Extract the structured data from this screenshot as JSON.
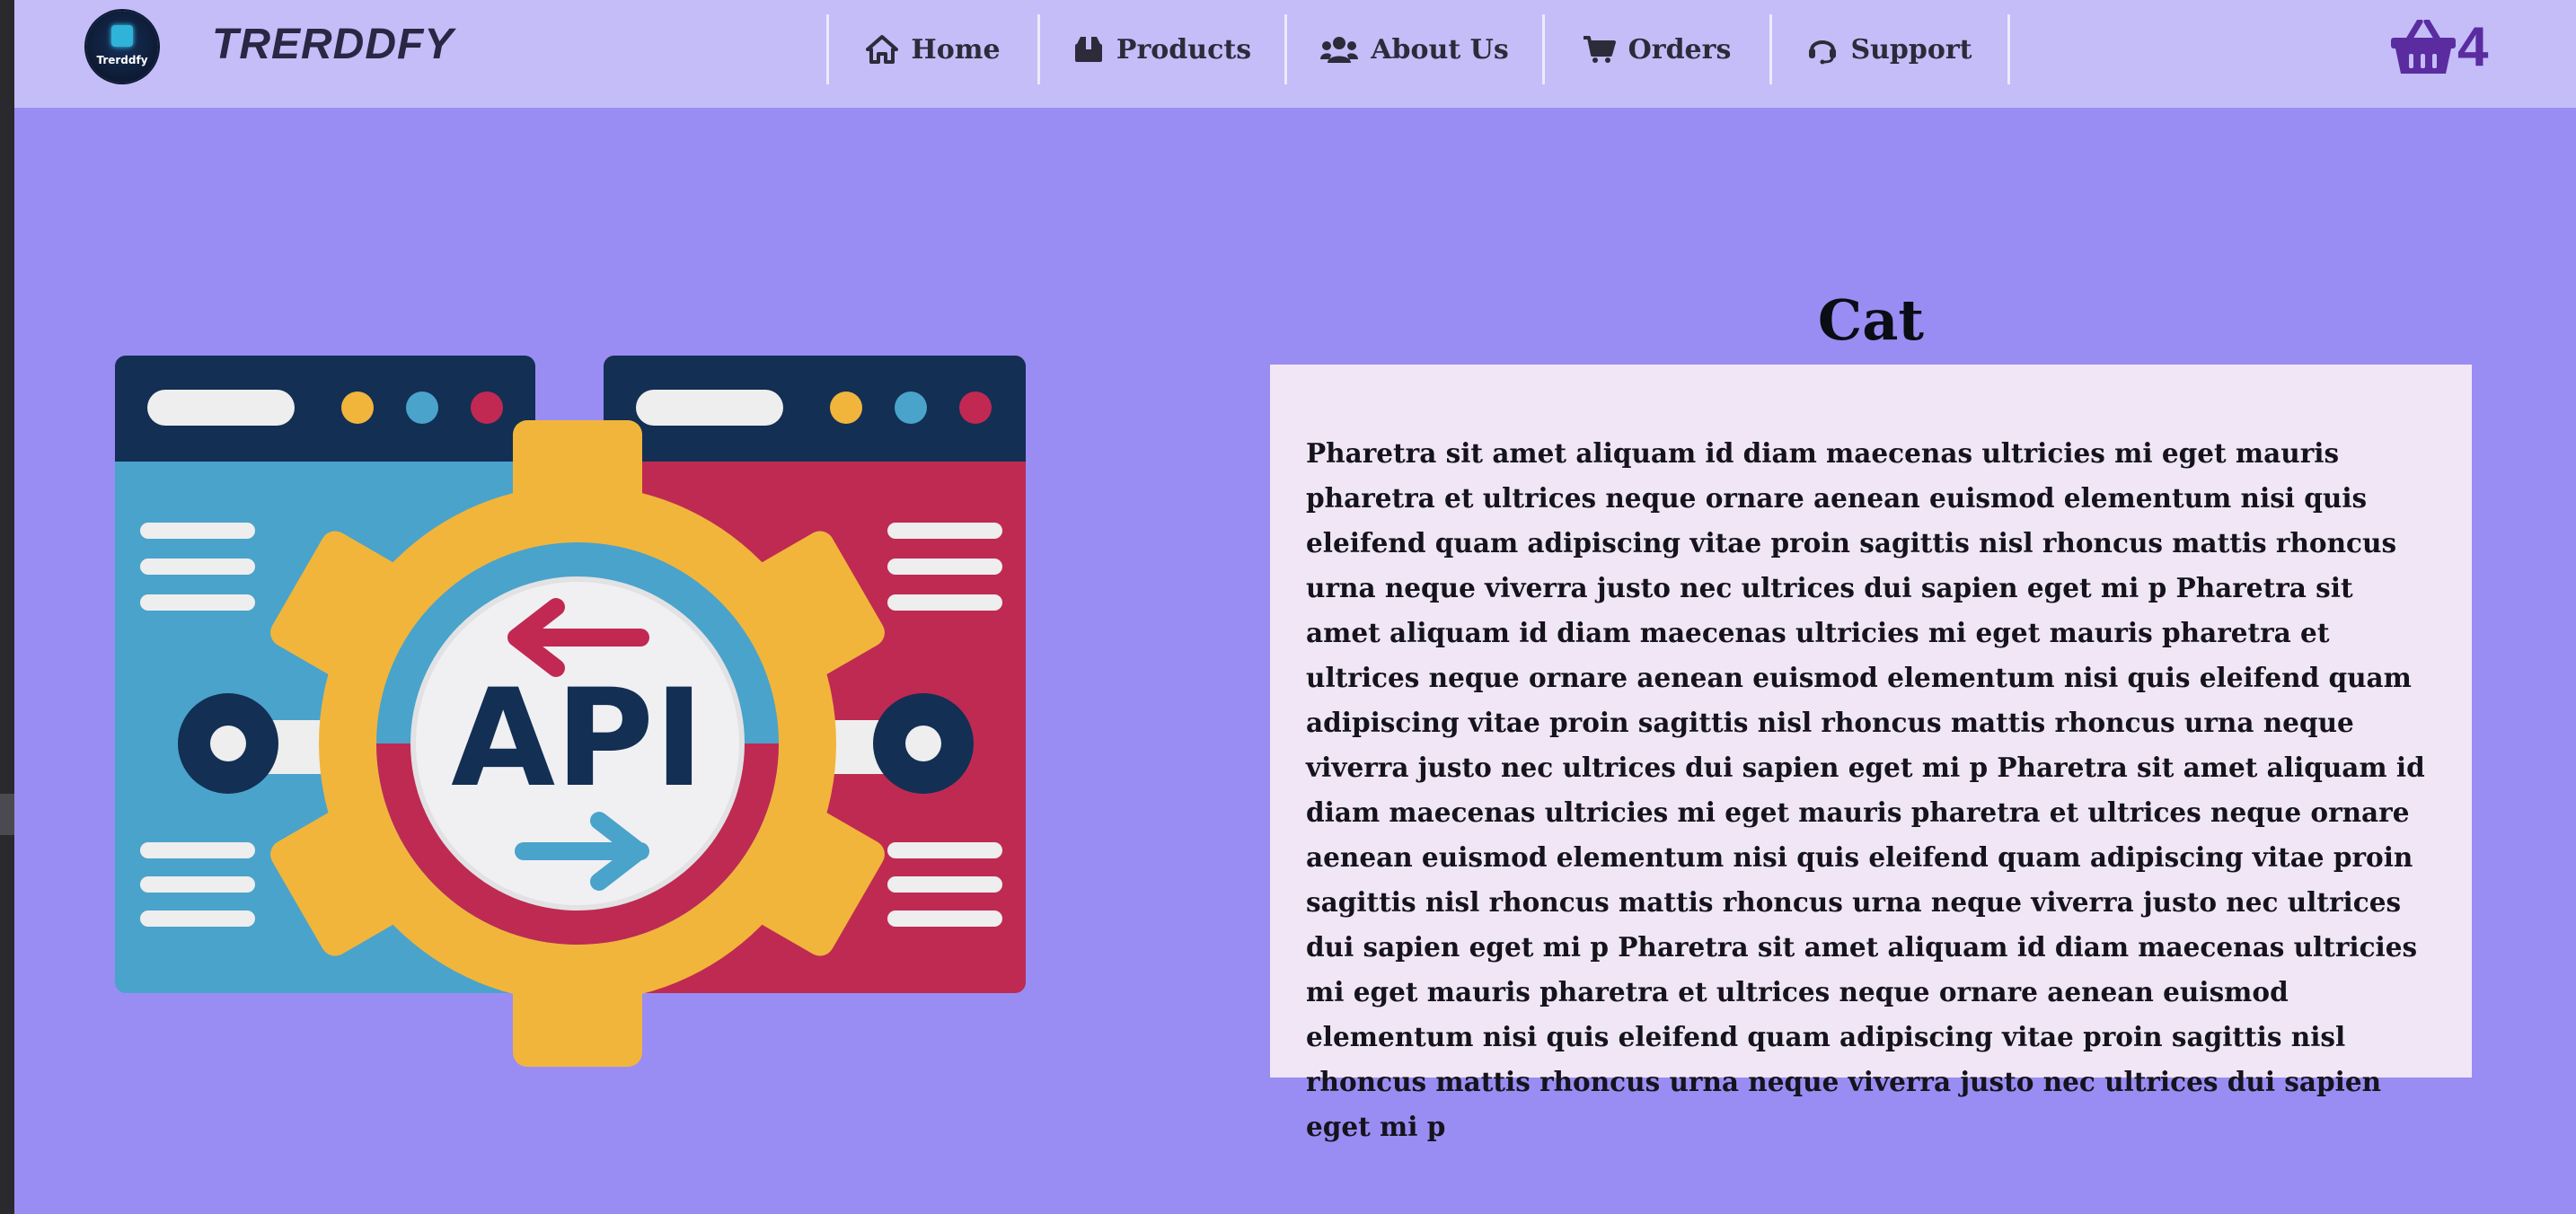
{
  "navbar": {
    "logo_text": "Trerddfy",
    "brand": "TRERDDFY",
    "items": [
      {
        "label": "Home",
        "icon": "home-icon"
      },
      {
        "label": "Products",
        "icon": "box-icon"
      },
      {
        "label": "About Us",
        "icon": "users-icon"
      },
      {
        "label": "Orders",
        "icon": "cart-icon"
      },
      {
        "label": "Support",
        "icon": "headset-icon"
      }
    ],
    "cart": {
      "icon": "basket-icon",
      "count": "4"
    }
  },
  "hero": {
    "image_icon": "api-gear-illustration",
    "image_text": "API"
  },
  "content": {
    "heading": "Cat",
    "paragraph": "Pharetra sit amet aliquam id diam maecenas ultricies mi eget mauris pharetra et ultrices neque ornare aenean euismod elementum nisi quis eleifend quam adipiscing vitae proin sagittis nisl rhoncus mattis rhoncus urna neque viverra justo nec ultrices dui sapien eget mi p Pharetra sit amet aliquam id diam maecenas ultricies mi eget mauris pharetra et ultrices neque ornare aenean euismod elementum nisi quis eleifend quam adipiscing vitae proin sagittis nisl rhoncus mattis rhoncus urna neque viverra justo nec ultrices dui sapien eget mi p Pharetra sit amet aliquam id diam maecenas ultricies mi eget mauris pharetra et ultrices neque ornare aenean euismod elementum nisi quis eleifend quam adipiscing vitae proin sagittis nisl rhoncus mattis rhoncus urna neque viverra justo nec ultrices dui sapien eget mi p Pharetra sit amet aliquam id diam maecenas ultricies mi eget mauris pharetra et ultrices neque ornare aenean euismod elementum nisi quis eleifend quam adipiscing vitae proin sagittis nisl rhoncus mattis rhoncus urna neque viverra justo nec ultrices dui sapien eget mi p"
  },
  "colors": {
    "page_bg": "#998df3",
    "navbar_bg": "#c4bdf8",
    "card_bg": "#f0e6f5",
    "accent_purple": "#5a2ca0"
  }
}
